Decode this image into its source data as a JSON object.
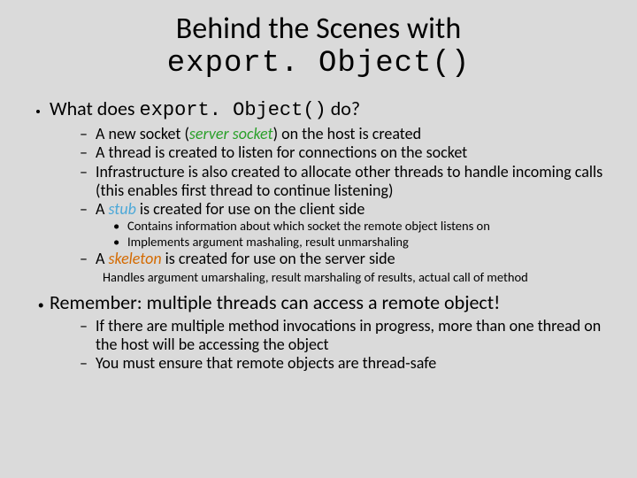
{
  "title": {
    "line1": "Behind the Scenes with",
    "code": "export. Object()"
  },
  "q": {
    "pre": "What does ",
    "code": "export. Object()",
    "post": " do?"
  },
  "steps": {
    "s1a": "A new socket (",
    "s1b": "server socket",
    "s1c": ") on the host is created",
    "s2": "A thread is created to listen for connections on the socket",
    "s3": "Infrastructure is also created to allocate other threads to handle incoming calls (this enables first thread to continue listening)",
    "s4a": "A ",
    "s4b": "stub",
    "s4c": " is created for use on the client side",
    "s4_1": "Contains information about which socket the remote object listens on",
    "s4_2": "Implements argument mashaling, result unmarshaling",
    "s5a": "A ",
    "s5b": "skeleton",
    "s5c": " is created for use on the server side",
    "s5_note": "Handles argument umarshaling, result marshaling of results, actual call of method"
  },
  "remember": {
    "head": "Remember:  multiple threads can access a remote object!",
    "r1": "If there are multiple method invocations in progress, more than one thread on the host will be accessing the object",
    "r2": "You must ensure that remote objects are thread-safe"
  }
}
